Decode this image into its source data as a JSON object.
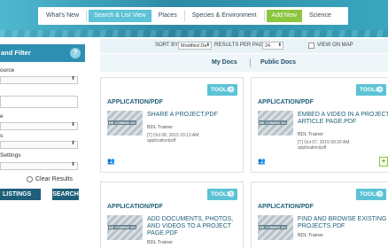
{
  "nav": {
    "tabs": [
      {
        "label": "What's New"
      },
      {
        "label": "Search & List View"
      },
      {
        "label": "Places"
      },
      {
        "label": "Species & Environment"
      },
      {
        "label": "Add New"
      },
      {
        "label": "Science"
      }
    ],
    "active_index": 1
  },
  "sidebar": {
    "header": "and Filter",
    "help_icon": "?",
    "labels": [
      "ource",
      "e",
      "s",
      "Settings"
    ],
    "clear_results": "Clear Results",
    "listings_button": "LISTINGS",
    "search_button": "SEARCH"
  },
  "sortbar": {
    "sort_by_label": "SORT BY",
    "sort_by_value": "Modified Da",
    "results_label": "RESULTS PER PAGE",
    "results_value": "24",
    "view_on_map": "VIEW ON MAP"
  },
  "docs_tabs": {
    "my_docs": "My Docs",
    "public_docs": "Public Docs"
  },
  "cards": [
    {
      "tools": "TOOLS",
      "category": "APPLICATION/PDF",
      "thumb_text": "BE COMING SO",
      "title": "SHARE A PROJECT.PDF",
      "author": "BDL Trainer",
      "date": "[T] Oct 08, 2015 10:13 AM",
      "type": "application/pdf"
    },
    {
      "tools": "TOOLS",
      "category": "APPLICATION/PDF",
      "thumb_text": "BE COMING SO",
      "title": "EMBED A VIDEO IN A PROJECT ARTICLE PAGE.PDF",
      "author": "BDL Trainer",
      "date": "[T] Oct 07, 2015 09:20 AM",
      "type": "application/pdf"
    },
    {
      "tools": "TOOLS",
      "category": "APPLICATION/PDF",
      "thumb_text": "BE COMING SO",
      "title": "ADD DOCUMENTS, PHOTOS, AND VIDEOS TO A PROJECT PAGE.PDF",
      "author": "BDL Trainer"
    },
    {
      "tools": "TOOLS",
      "category": "APPLICATION/PDF",
      "thumb_text": "BE COMING SO",
      "title": "FIND AND BROWSE EXISTING PROJECTS.PDF",
      "author": "BDL Trainer"
    }
  ],
  "colors": {
    "accent": "#5bc3d5",
    "add_new": "#8cc63f",
    "dark_button": "#1f5f7a",
    "filter_header": "#2f8fb3"
  }
}
